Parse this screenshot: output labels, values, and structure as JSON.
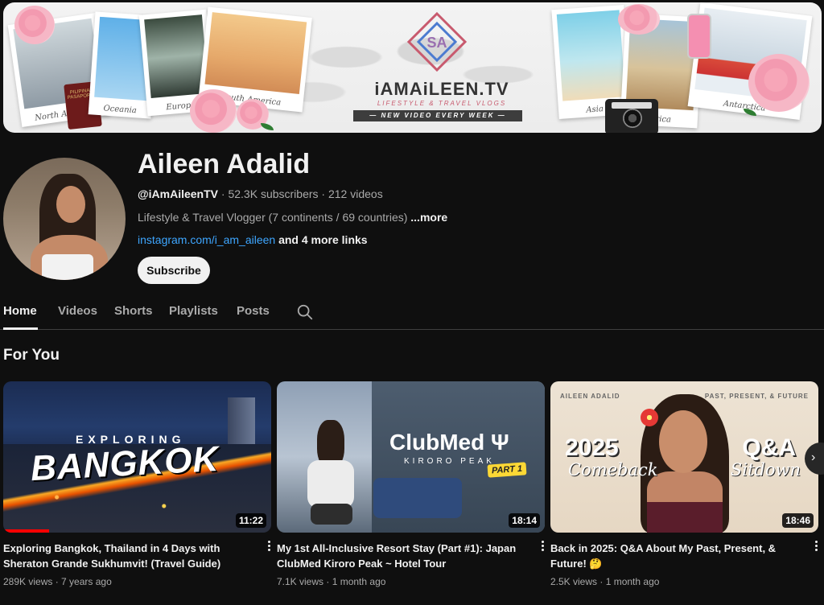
{
  "banner": {
    "logo_text": "iAMAiLEEN.TV",
    "logo_subtitle": "LIFESTYLE & TRAVEL VLOGS",
    "logo_tagline": "— NEW VIDEO EVERY WEEK —",
    "captions": [
      "North America",
      "Oceania",
      "Europe",
      "South America",
      "Asia",
      "Africa",
      "Antarctica"
    ],
    "passport_label": "PILIPINAS PASAPORTE"
  },
  "channel": {
    "name": "Aileen Adalid",
    "handle": "@iAmAileenTV",
    "subscribers": "52.3K subscribers",
    "videos": "212 videos",
    "separator": " · ",
    "description": "Lifestyle & Travel Vlogger (7 continents / 69 countries) ",
    "more_label": "...more",
    "link_text": "instagram.com/i_am_aileen",
    "more_links": " and 4 more links",
    "subscribe_label": "Subscribe"
  },
  "tabs": [
    "Home",
    "Videos",
    "Shorts",
    "Playlists",
    "Posts"
  ],
  "section_title": "For You",
  "videos": [
    {
      "title": "Exploring Bangkok, Thailand in 4 Days with Sheraton Grande Sukhumvit! (Travel Guide)",
      "views": "289K views",
      "age": "7 years ago",
      "duration": "11:22",
      "watched_fraction": 0.17,
      "thumb_small": "EXPLORING",
      "thumb_big": "BANGKOK"
    },
    {
      "title": "My 1st All-Inclusive Resort Stay (Part #1): Japan ClubMed Kiroro Peak ~ Hotel Tour",
      "views": "7.1K views",
      "age": "1 month ago",
      "duration": "18:14",
      "thumb_logo": "ClubMed Ψ",
      "thumb_sub": "KIRORO PEAK",
      "thumb_part": "PART 1"
    },
    {
      "title": "Back in 2025: Q&A About My Past, Present, & Future! 🤔",
      "views": "2.5K views",
      "age": "1 month ago",
      "duration": "18:46",
      "thumb_tl": "AILEEN ADALID",
      "thumb_tr": "PAST, PRESENT, & FUTURE",
      "thumb_year": "2025",
      "thumb_comeback": "Comeback",
      "thumb_qa": "Q&A",
      "thumb_sitdown": "Sitdown"
    }
  ],
  "icons": {
    "search": "search-icon",
    "kebab": "more-vert-icon",
    "next": "chevron-right-icon"
  },
  "colors": {
    "background": "#0f0f0f",
    "link": "#3ea6ff",
    "progress": "#ff0000"
  }
}
